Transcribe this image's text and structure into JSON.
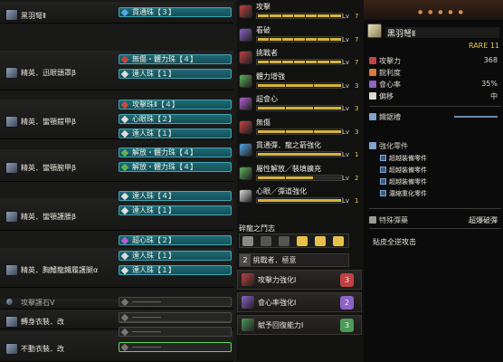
{
  "colors": {
    "accent": "#d6b43c",
    "deco_fill": "#1f6a76",
    "deco_border": "#43a6b4",
    "selected_border": "#5fd85a"
  },
  "equipment": [
    {
      "name": "黑羽弩Ⅱ",
      "icon": "bow-icon",
      "decorations": [
        {
          "label": "貫通珠【３】",
          "color": "#55a7e6"
        }
      ]
    },
    {
      "name": "精英．迅眼頭罩β",
      "icon": "helmet-icon",
      "decorations": [
        {
          "label": "無傷・體力珠【４】",
          "color": "#c84444"
        },
        {
          "label": "達人珠【１】",
          "color": "#ddd"
        }
      ]
    },
    {
      "name": "精英．蠻顎鎧甲β",
      "icon": "chest-armor-icon",
      "decorations": [
        {
          "label": "攻擊珠Ⅱ【４】",
          "color": "#d24a3a"
        },
        {
          "label": "心眼珠【２】",
          "color": "#ddd"
        },
        {
          "label": "達人珠【１】",
          "color": "#ddd"
        }
      ]
    },
    {
      "name": "精英．蠻顎腕甲β",
      "icon": "arm-armor-icon",
      "decorations": [
        {
          "label": "解放・體力珠【４】",
          "color": "#5fb35a"
        },
        {
          "label": "解放・體力珠【４】",
          "color": "#5fb35a"
        }
      ]
    },
    {
      "name": "精英．蠻顎護腰β",
      "icon": "waist-armor-icon",
      "decorations": [
        {
          "label": "達人珠【４】",
          "color": "#ddd"
        },
        {
          "label": "達人珠【１】",
          "color": "#ddd"
        }
      ]
    },
    {
      "name": "精英．胸鰭龍鐵履護腿α",
      "icon": "leg-armor-icon",
      "decorations": [
        {
          "label": "超心珠【２】",
          "color": "#b061d4"
        },
        {
          "label": "達人珠【１】",
          "color": "#ddd"
        },
        {
          "label": "達人珠【１】",
          "color": "#ddd"
        }
      ]
    },
    {
      "name": "攻擊護石Ⅴ",
      "icon": "charm-icon",
      "decorations": []
    },
    {
      "name": "轉身衣裝．改",
      "icon": "mantle-icon",
      "decorations": [
        {
          "label": "――――",
          "color": "#777"
        },
        {
          "label": "――――",
          "color": "#777"
        }
      ]
    },
    {
      "name": "不動衣裝．改",
      "icon": "mantle-icon",
      "decorations": [
        {
          "label": "――――",
          "color": "#777"
        },
        {
          "label": "――――",
          "color": "#777"
        },
        {
          "label": "――――",
          "color": "#777"
        }
      ]
    }
  ],
  "skills": [
    {
      "name": "攻擊",
      "lv_label": "Lv",
      "level": "7",
      "filled": 7,
      "max": 7,
      "color": "#c04343"
    },
    {
      "name": "看破",
      "lv_label": "Lv",
      "level": "7",
      "filled": 7,
      "max": 7,
      "color": "#8d63c8"
    },
    {
      "name": "挑戰者",
      "lv_label": "Lv",
      "level": "7",
      "filled": 7,
      "max": 7,
      "color": "#c04343"
    },
    {
      "name": "體力增強",
      "lv_label": "Lv",
      "level": "3",
      "filled": 3,
      "max": 3,
      "color": "#5fb35a"
    },
    {
      "name": "超會心",
      "lv_label": "Lv",
      "level": "3",
      "filled": 3,
      "max": 3,
      "color": "#b061d4"
    },
    {
      "name": "無傷",
      "lv_label": "Lv",
      "level": "3",
      "filled": 3,
      "max": 3,
      "color": "#c84444"
    },
    {
      "name": "貫通彈．龍之箭強化",
      "lv_label": "Lv",
      "level": "1",
      "filled": 1,
      "max": 1,
      "color": "#55a7e6"
    },
    {
      "name": "屬性解放／裝填擴充",
      "lv_label": "Lv",
      "level": "2",
      "filled": 2,
      "max": 3,
      "color": "#5fb35a"
    },
    {
      "name": "心眼／彈道強化",
      "lv_label": "Lv",
      "level": "1",
      "filled": 1,
      "max": 1,
      "color": "#dddddd"
    }
  ],
  "set_bonus": {
    "title": "碎龍之鬥志",
    "count": "2",
    "item": "挑戰者．極意",
    "kinship": [
      {
        "name": "攻擊力強化Ⅰ",
        "count": "3",
        "color": "#c04343"
      },
      {
        "name": "會心率強化Ⅰ",
        "count": "2",
        "color": "#8d63c8"
      },
      {
        "name": "賦予回復能力Ⅰ",
        "count": "3",
        "color": "#4c9a59"
      }
    ]
  },
  "weapon": {
    "name": "黑羽弩Ⅱ",
    "rarity": "RARE 11",
    "stats": [
      {
        "label": "攻擊力",
        "value": "368"
      },
      {
        "label": "銳利度",
        "value": ""
      },
      {
        "label": "會心率",
        "value": "35%"
      },
      {
        "label": "偏移",
        "value": "中"
      }
    ],
    "coating_label": "鐵鋸槽",
    "upgrades_title": "強化零件",
    "upgrades": [
      "超越裝備零件",
      "超越裝備零件",
      "超越裝備零件",
      "濃縮重化零件"
    ],
    "special_label": "特殊彈藥",
    "special_value": "超爆破彈",
    "footer": "貼皮全逆攻击"
  }
}
